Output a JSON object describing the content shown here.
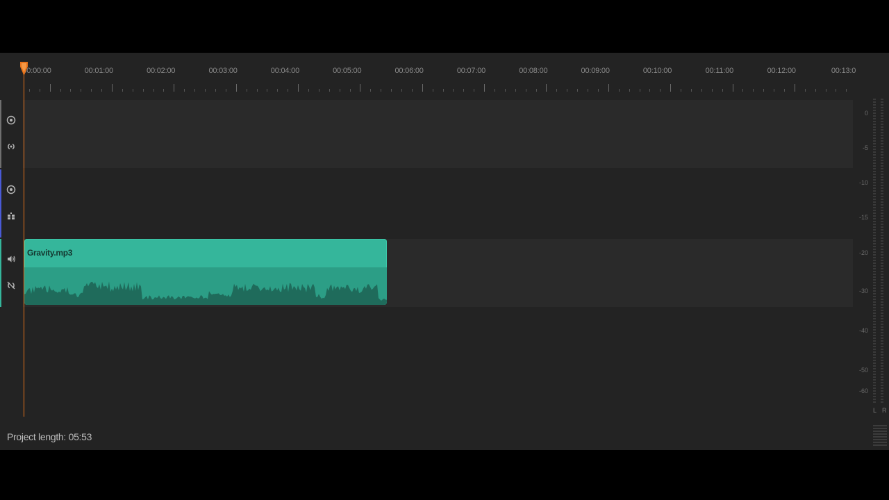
{
  "timeline": {
    "ruler_labels": [
      "00:00:00",
      "00:01:00",
      "00:02:00",
      "00:03:00",
      "00:04:00",
      "00:05:00",
      "00:06:00",
      "00:07:00",
      "00:08:00",
      "00:09:00",
      "00:10:00",
      "00:11:00",
      "00:12:00",
      "00:13:0"
    ],
    "playhead_time": "00:00:00"
  },
  "tracks": [
    {
      "type": "video",
      "color": "#6f6f6f",
      "icons": [
        "visibility-icon",
        "link-icon"
      ]
    },
    {
      "type": "effects",
      "color": "#4a5ad6",
      "icons": [
        "visibility-icon",
        "effects-icon"
      ]
    },
    {
      "type": "audio",
      "color": "#35b69b",
      "icons": [
        "speaker-icon",
        "unlink-icon"
      ]
    }
  ],
  "clip": {
    "name": "Gravity.mp3",
    "color": "#35b69b",
    "start": "00:00:00",
    "length": "05:53"
  },
  "status": {
    "project_length": "Project length: 05:53"
  },
  "meter": {
    "scale": [
      "0",
      "-5",
      "-10",
      "-15",
      "-20",
      "-30",
      "-40",
      "-50",
      "-60"
    ],
    "channels": [
      "L",
      "R"
    ]
  },
  "colors": {
    "playhead": "#e8731b",
    "background": "#232323",
    "track_lane": "#2a2a2a"
  }
}
